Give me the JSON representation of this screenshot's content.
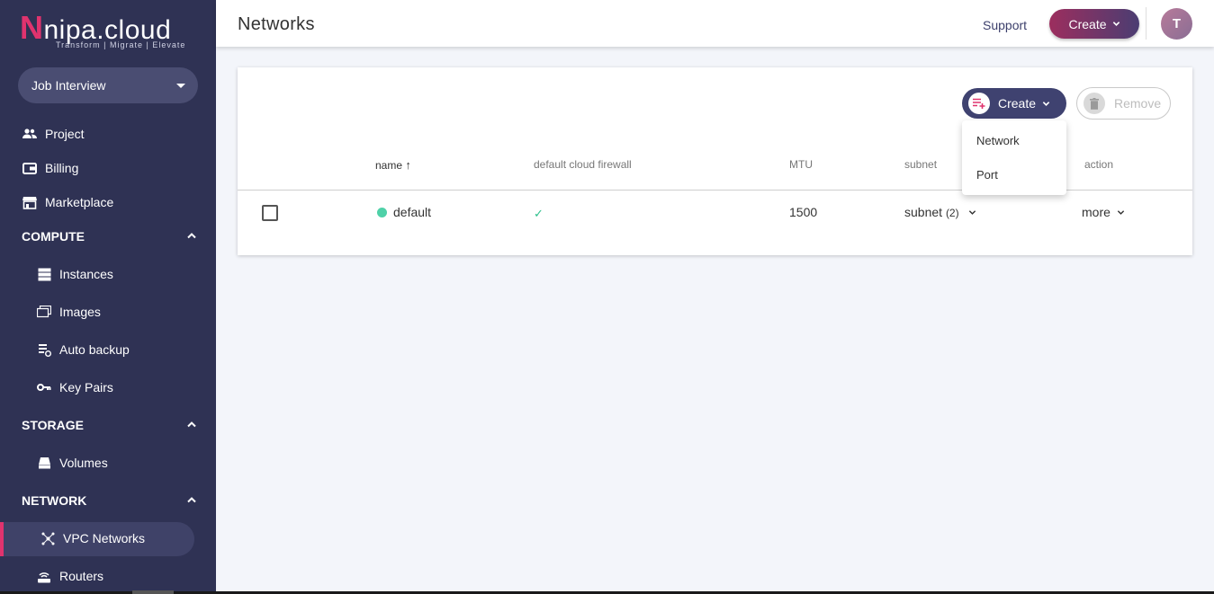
{
  "brand": {
    "logo_letter": "N",
    "logo_rest": "nipa.cloud",
    "tagline": "Transform | Migrate | Elevate"
  },
  "project": {
    "selected": "Job Interview"
  },
  "sidebar": {
    "top_items": [
      {
        "label": "Project",
        "icon": "users-icon"
      },
      {
        "label": "Billing",
        "icon": "wallet-icon"
      },
      {
        "label": "Marketplace",
        "icon": "store-icon"
      }
    ],
    "sections": [
      {
        "label": "COMPUTE",
        "items": [
          {
            "label": "Instances",
            "icon": "server-icon"
          },
          {
            "label": "Images",
            "icon": "images-icon"
          },
          {
            "label": "Auto backup",
            "icon": "backup-icon"
          },
          {
            "label": "Key Pairs",
            "icon": "key-icon"
          }
        ]
      },
      {
        "label": "STORAGE",
        "items": [
          {
            "label": "Volumes",
            "icon": "drive-icon"
          }
        ]
      },
      {
        "label": "NETWORK",
        "items": [
          {
            "label": "VPC Networks",
            "icon": "network-icon",
            "active": true
          },
          {
            "label": "Routers",
            "icon": "router-icon"
          }
        ]
      }
    ]
  },
  "header": {
    "title": "Networks",
    "support_label": "Support",
    "create_label": "Create",
    "avatar_initial": "T"
  },
  "toolbar": {
    "create_label": "Create",
    "remove_label": "Remove"
  },
  "dropdown": {
    "items": [
      "Network",
      "Port"
    ]
  },
  "table": {
    "columns": [
      "name",
      "default cloud firewall",
      "MTU",
      "subnet",
      "action"
    ],
    "sort_indicator": "↑",
    "rows": [
      {
        "name": "default",
        "status_color": "#4fd1a8",
        "firewall": "✓",
        "mtu": "1500",
        "subnet_label": "subnet",
        "subnet_count": "(2)",
        "action": "more"
      }
    ]
  },
  "colors": {
    "sidebar_bg": "#2f3254",
    "accent": "#e0336e",
    "primary": "#3f4270"
  }
}
